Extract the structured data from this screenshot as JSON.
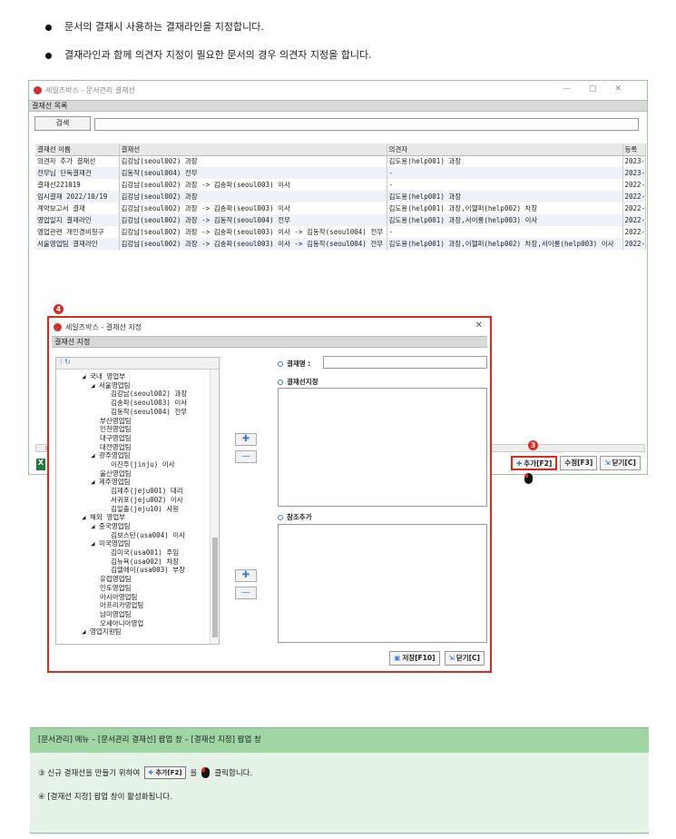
{
  "bullets": [
    "문서의 결재시 사용하는 결재라인을 지정합니다.",
    "결재라인과 함께 의견자 지정이 필요한 문서의 경우 의견자 지정을 합니다."
  ],
  "main_window": {
    "title": "세일즈박스 - 문서관리 결재선",
    "section_title": "결재선 목록",
    "search_label": "검색",
    "columns": [
      "결재선 이름",
      "결재선",
      "의견자",
      "등록"
    ],
    "rows": [
      [
        "의견자 추가 결재선",
        "김강남(seoul002) 과장",
        "김도용(help001) 과장",
        "2023-"
      ],
      [
        "전무님 단독결재건",
        "김동작(seoul004) 전무",
        "-",
        "2023-"
      ],
      [
        "결재선221019",
        "김강남(seoul002) 과장 -> 김송파(seoul003) 이사",
        "-",
        "2022-"
      ],
      [
        "임시결재 2022/10/19",
        "김강남(seoul002) 과장",
        "김도용(help001) 과장",
        "2022-"
      ],
      [
        "계약보고서 결재",
        "김강남(seoul002) 과장 -> 김송파(seoul003) 이사",
        "김도용(help001) 과장,이헬퍼(help002) 차장",
        "2022-"
      ],
      [
        "영업일지 결재라인",
        "김강남(seoul002) 과장 -> 김동작(seoul004) 전무",
        "김도용(help001) 과장,서이롱(help003) 이사",
        "2022-"
      ],
      [
        "영업관련 개인경비청구",
        "김강남(seoul002) 과장 -> 김송파(seoul003) 이사 -> 김동작(seoul004) 전무",
        "-",
        "2022-"
      ],
      [
        "서울영업팀 결재라인",
        "김강남(seoul002) 과장 -> 김송파(seoul003) 이사 -> 김동작(seoul004) 전무",
        "김도용(help001) 과장,이헬퍼(help002) 차장,서이롱(help003) 이사",
        "2022-"
      ]
    ],
    "buttons": {
      "add": "추가[F2]",
      "edit": "수정[F3]",
      "close": "닫기[C]"
    },
    "excel": "X"
  },
  "markers": {
    "m3": "3",
    "m4": "4"
  },
  "popup": {
    "title": "세일즈박스 - 결재선 지정",
    "section_title": "결재선 지정",
    "tree": [
      {
        "t": "◢ 국내 영업부",
        "lv": 1
      },
      {
        "t": "◢ 서울영업팀",
        "lv": 2
      },
      {
        "t": "김강남(seoul002) 과장",
        "lv": 4
      },
      {
        "t": "김송파(seoul003) 이사",
        "lv": 4
      },
      {
        "t": "김동작(seoul004) 전무",
        "lv": 4
      },
      {
        "t": "부산영업팀",
        "lv": 3
      },
      {
        "t": "인천영업팀",
        "lv": 3
      },
      {
        "t": "대구영업팀",
        "lv": 3
      },
      {
        "t": "대전영업팀",
        "lv": 3
      },
      {
        "t": "◢ 광주영업팀",
        "lv": 2
      },
      {
        "t": "이진주(jinju) 이사",
        "lv": 4
      },
      {
        "t": "울산영업팀",
        "lv": 3
      },
      {
        "t": "◢ 제주영업팀",
        "lv": 2
      },
      {
        "t": "김제주(jeju001) 대리",
        "lv": 4
      },
      {
        "t": "서귀포(jeju002) 이사",
        "lv": 4
      },
      {
        "t": "김일출(jeju10) 사원",
        "lv": 4
      },
      {
        "t": "◢ 해외 영업부",
        "lv": 1
      },
      {
        "t": "◢ 중국영업팀",
        "lv": 2
      },
      {
        "t": "김보스턴(usa004) 이사",
        "lv": 4
      },
      {
        "t": "◢ 미국영업팀",
        "lv": 2
      },
      {
        "t": "김미국(usa001) 주임",
        "lv": 4
      },
      {
        "t": "김뉴욕(usa002) 차장",
        "lv": 4
      },
      {
        "t": "김엘에이(usa003) 부장",
        "lv": 4
      },
      {
        "t": "유럽영업팀",
        "lv": 3
      },
      {
        "t": "인도영업팀",
        "lv": 3
      },
      {
        "t": "아시아영업팀",
        "lv": 3
      },
      {
        "t": "아프리카영업팀",
        "lv": 3
      },
      {
        "t": "남미영업팀",
        "lv": 3
      },
      {
        "t": "오세아니아영업",
        "lv": 3
      },
      {
        "t": "◢ 영업지원팀",
        "lv": 1
      }
    ],
    "label_name": "결재명 :",
    "label_approval": "결재선지정",
    "label_ref": "참조추가",
    "save": "저장[F10]",
    "close": "닫기[C]"
  },
  "info": {
    "header": "[문서관리] 메뉴 – [문서관리 결재선] 팝업 창 – [결재선 지정] 팝업 창",
    "line3_a": "③  신규 결재선을 만들기 위하여",
    "line3_btn": "추가[F2]",
    "line3_b": "을",
    "line3_c": "클릭합니다.",
    "line4": "④  [결재선 지정] 팝업 창이 활성화됩니다."
  }
}
